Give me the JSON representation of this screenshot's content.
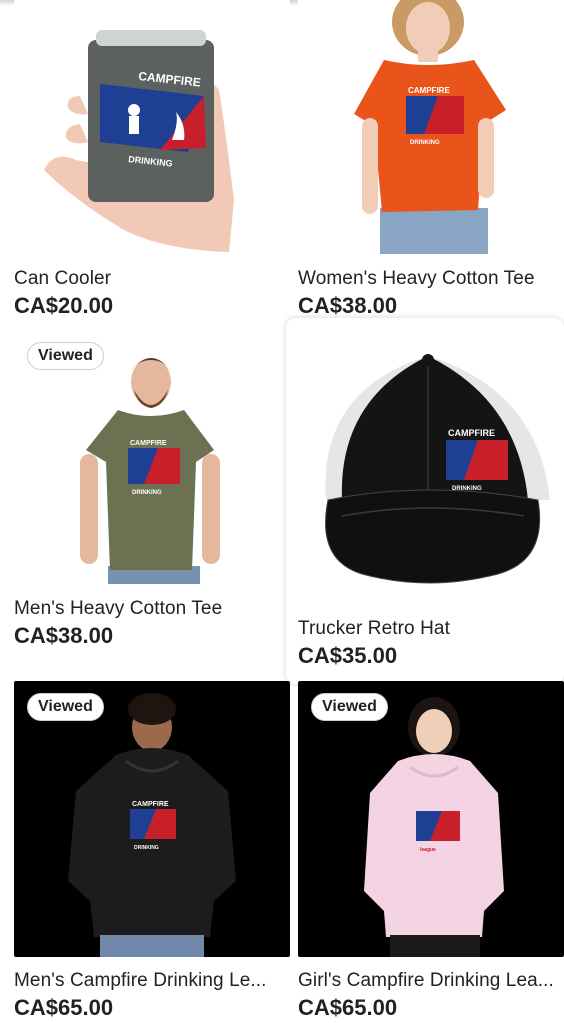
{
  "products": [
    {
      "title": "Can Cooler",
      "price": "CA$20.00",
      "viewed": false,
      "image": "can-cooler-image"
    },
    {
      "title": "Women's Heavy Cotton Tee",
      "price": "CA$38.00",
      "viewed": false,
      "image": "womens-tee-image"
    },
    {
      "title": "Men's Heavy Cotton Tee",
      "price": "CA$38.00",
      "viewed": true,
      "image": "mens-tee-image"
    },
    {
      "title": "Trucker Retro Hat",
      "price": "CA$35.00",
      "viewed": false,
      "image": "trucker-hat-image"
    },
    {
      "title": "Men's Campfire Drinking Le...",
      "price": "CA$65.00",
      "viewed": true,
      "image": "mens-hoodie-image"
    },
    {
      "title": "Girl's Campfire Drinking Lea...",
      "price": "CA$65.00",
      "viewed": true,
      "image": "girls-hoodie-image"
    }
  ],
  "badge_label": "Viewed",
  "logo_text": {
    "top": "CAMPFIRE",
    "bottom": "DRINKING",
    "script": "league"
  },
  "colors": {
    "logo_blue": "#1f3f94",
    "logo_red": "#c8202a",
    "orange_tee": "#e9541a",
    "olive_tee": "#6b7151",
    "pink_hoodie": "#f4d3e2",
    "hat": "#101010",
    "cooler": "#5c605e"
  }
}
